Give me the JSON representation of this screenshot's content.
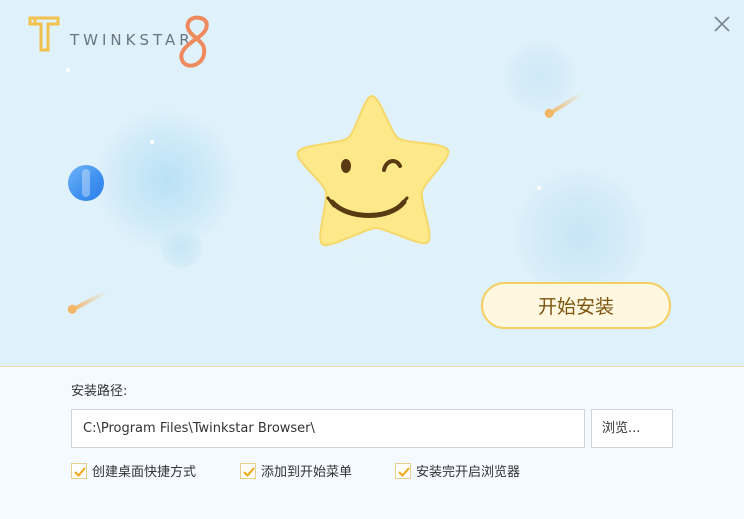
{
  "header": {
    "brand_text": "TWINKSTAR",
    "brand_version": "8",
    "close_icon": "close-icon"
  },
  "hero": {
    "start_button_label": "开始安装"
  },
  "install": {
    "path_label": "安装路径:",
    "path_value": "C:\\Program Files\\Twinkstar Browser\\",
    "browse_label": "浏览..."
  },
  "options": [
    {
      "label": "创建桌面快捷方式",
      "checked": true
    },
    {
      "label": "添加到开始菜单",
      "checked": true
    },
    {
      "label": "安装完开启浏览器",
      "checked": true
    }
  ],
  "colors": {
    "accent": "#f5cf5f",
    "brand_orange": "#ee8a5e",
    "hero_bg": "#dff1fb",
    "star": "#fde98a"
  }
}
